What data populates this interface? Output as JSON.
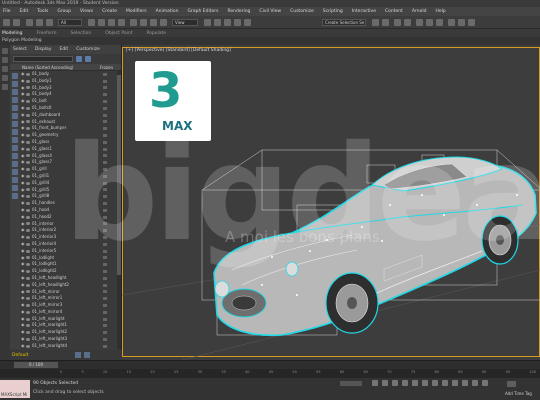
{
  "window": {
    "title": "Untitled - Autodesk 3ds Max 2019 - Student Version"
  },
  "menu": [
    "File",
    "Edit",
    "Tools",
    "Group",
    "Views",
    "Create",
    "Modifiers",
    "Animation",
    "Graph Editors",
    "Rendering",
    "Civil View",
    "Customize",
    "Scripting",
    "Interactive",
    "Content",
    "Arnold",
    "Help"
  ],
  "toolbar": {
    "view_dropdown": "View",
    "selection_set": "Create Selection Se"
  },
  "ribbon": {
    "tabs": [
      "Modeling",
      "Freeform",
      "Selection",
      "Object Paint",
      "Populate"
    ],
    "active_tab": "Modeling",
    "subtitle": "Polygon Modeling"
  },
  "scene_explorer": {
    "menu": [
      "Select",
      "Display",
      "Edit",
      "Customize"
    ],
    "columns": [
      "Name (Sorted Ascending)",
      "Frozen"
    ],
    "rows": [
      "01_body",
      "01_body1",
      "01_body3",
      "01_body4",
      "01_bolt",
      "01_bolts0",
      "01_dashboard",
      "01_exhaust",
      "01_front_bumper",
      "01_geometry",
      "01_glass",
      "01_glass1",
      "01_glass4",
      "01_glass7",
      "01_grill",
      "01_grill1",
      "01_grill4",
      "01_grill5",
      "01_grill8",
      "01_handles",
      "01_hood",
      "01_hood2",
      "01_interior",
      "01_interior2",
      "01_interior3",
      "01_interior4",
      "01_interior5",
      "01_lodlight",
      "01_lodlight1",
      "01_lodlight2",
      "01_left_headlight",
      "01_left_headlight2",
      "01_left_mirror",
      "01_left_mirror1",
      "01_left_mirror3",
      "01_left_mirror4",
      "01_left_rearlight",
      "01_left_rearlight1",
      "01_left_rearlight2",
      "01_left_rearlight3",
      "01_left_rearlight4"
    ],
    "layer": "Default"
  },
  "viewport": {
    "label": "[+] [Perspective] [Standard] [Default Shading]",
    "logo_number": "3",
    "logo_text": "MAX"
  },
  "watermark": {
    "brand": "bigdeal",
    "tagline": "A moi les bons plans"
  },
  "timeline": {
    "frame": "0 / 100",
    "ticks": [
      "0",
      "5",
      "10",
      "15",
      "20",
      "25",
      "30",
      "35",
      "40",
      "45",
      "50",
      "55",
      "60",
      "65",
      "70",
      "75",
      "80",
      "85",
      "90",
      "95",
      "100"
    ]
  },
  "status": {
    "script_label": "MAXScript Mi",
    "selection": "90 Objects Selected",
    "hint": "Click and drag to select objects",
    "add_time_tag": "Add Time Tag"
  },
  "colors": {
    "wire_cyan": "#1fd9e6",
    "viewport_border": "#d89a20",
    "logo_teal": "#1f9b8f"
  }
}
